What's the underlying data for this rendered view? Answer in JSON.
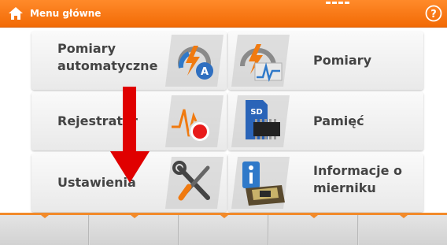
{
  "topbar": {
    "title": "Menu główne",
    "home_icon": "home-icon",
    "help_icon": "help-icon",
    "accent_color": "#f26a05"
  },
  "tiles": [
    {
      "label": "Pomiary automatyczne",
      "icon": "auto-measurement-icon"
    },
    {
      "label": "Pomiary",
      "icon": "measurement-icon"
    },
    {
      "label": "Rejestrator",
      "icon": "recorder-icon"
    },
    {
      "label": "Pamięć",
      "icon": "memory-card-icon"
    },
    {
      "label": "Ustawienia",
      "icon": "settings-tools-icon"
    },
    {
      "label": "Informacje o mierniku",
      "icon": "meter-info-icon"
    }
  ],
  "annotation": {
    "type": "red-arrow-down",
    "color": "#e00000"
  }
}
